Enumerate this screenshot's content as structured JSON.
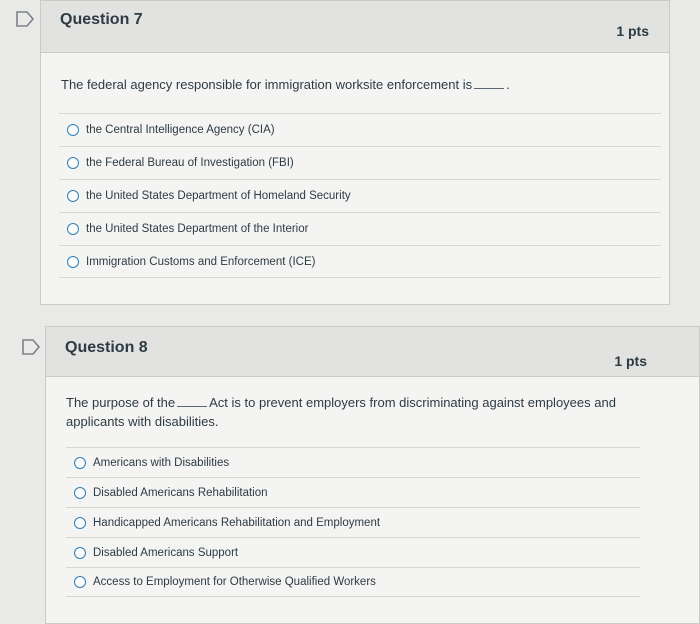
{
  "questions": [
    {
      "title": "Question 7",
      "points": "1 pts",
      "text_before": "The federal agency responsible for immigration worksite enforcement is",
      "text_after": ".",
      "answers": [
        "the Central Intelligence Agency (CIA)",
        "the Federal Bureau of Investigation (FBI)",
        "the United States Department of Homeland Security",
        "the United States Department of the Interior",
        "Immigration Customs and Enforcement (ICE)"
      ]
    },
    {
      "title": "Question 8",
      "points": "1 pts",
      "text_before": "The purpose of the",
      "text_after": "Act is to prevent employers from discriminating against employees and applicants with disabilities.",
      "answers": [
        "Americans with Disabilities",
        "Disabled Americans Rehabilitation",
        "Handicapped Americans Rehabilitation and Employment",
        "Disabled Americans Support",
        "Access to Employment for Otherwise Qualified Workers"
      ]
    }
  ],
  "colors": {
    "background": "#e9e9e7",
    "card": "#f4f4f2",
    "header": "#e2e3e1",
    "radio_border": "#2d7fb8",
    "text": "#2d3b45"
  },
  "icons": {
    "flag": "flag-question-icon"
  }
}
